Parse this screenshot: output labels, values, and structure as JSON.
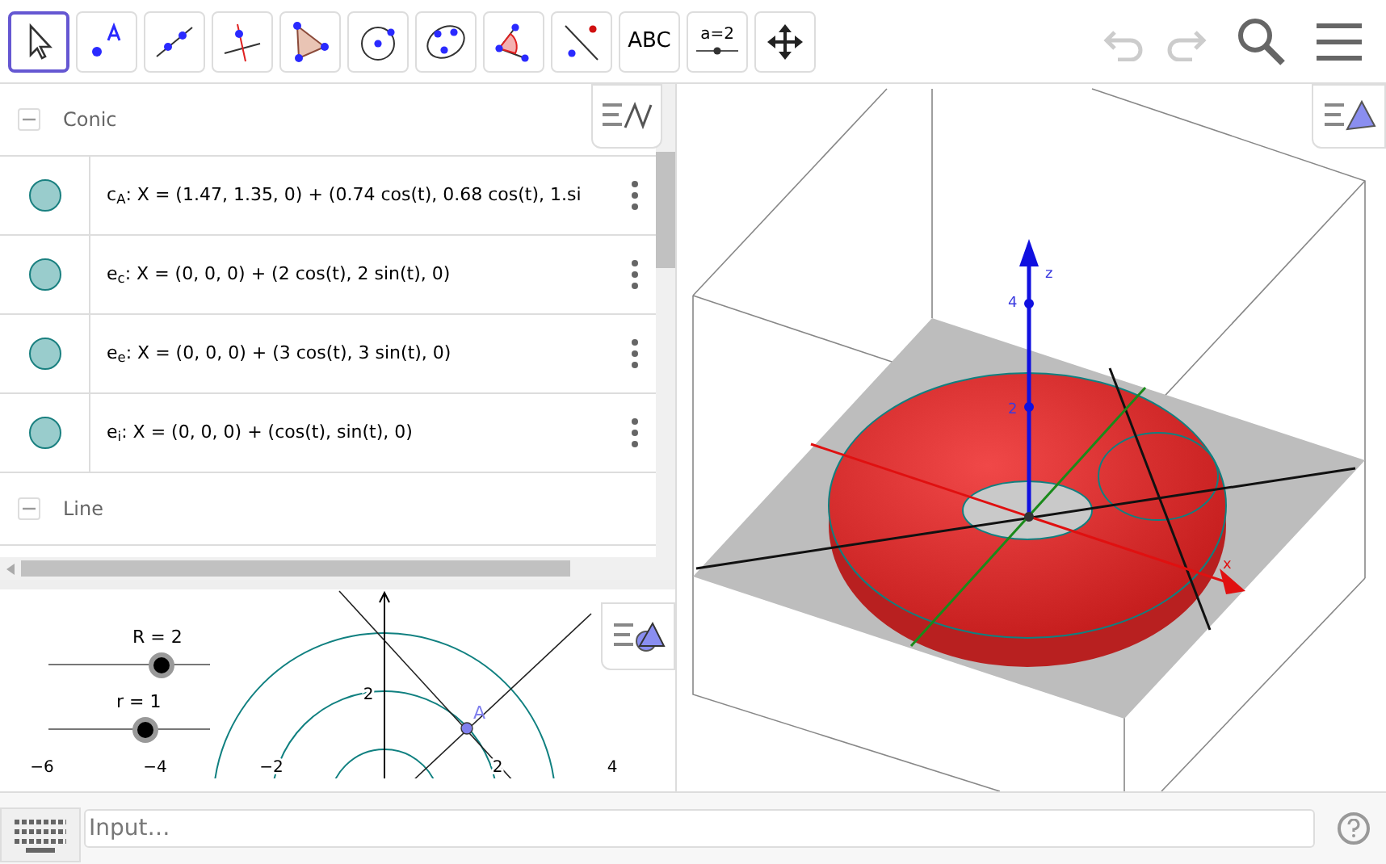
{
  "toolbar": {
    "tools": [
      {
        "kind": "move",
        "selected": true
      },
      {
        "kind": "point",
        "selected": false
      },
      {
        "kind": "line",
        "selected": false
      },
      {
        "kind": "perpendicular",
        "selected": false
      },
      {
        "kind": "polygon",
        "selected": false
      },
      {
        "kind": "circle",
        "selected": false
      },
      {
        "kind": "conic",
        "selected": false
      },
      {
        "kind": "angle",
        "selected": false
      },
      {
        "kind": "reflect",
        "selected": false
      },
      {
        "kind": "text",
        "label": "ABC",
        "selected": false
      },
      {
        "kind": "slider",
        "label": "a=2",
        "selected": false
      },
      {
        "kind": "pan",
        "selected": false
      }
    ],
    "undo": {
      "disabled": true
    },
    "redo": {
      "disabled": true
    }
  },
  "algebra": {
    "groups": [
      {
        "title": "Conic",
        "expanded": true,
        "rows": [
          {
            "text": "c$_{A}$: X = (1.47, 1.35, 0) + (0.74 cos(t), 0.68 cos(t), 1.si"
          },
          {
            "text": "e$_{c}$: X = (0, 0, 0) + (2 cos(t), 2 sin(t), 0)"
          },
          {
            "text": "e$_{e}$: X = (0, 0, 0) + (3 cos(t), 3 sin(t), 0)"
          },
          {
            "text": "e$_{i}$: X = (0, 0, 0) + (cos(t), sin(t), 0)"
          }
        ]
      },
      {
        "title": "Line",
        "expanded": true
      }
    ]
  },
  "graphics": {
    "sliders": [
      {
        "label": "R = 2",
        "level": 0.7
      },
      {
        "label": "r = 1",
        "level": 0.6
      }
    ],
    "x_ticks": [
      "−6",
      "−4",
      "−2",
      "2",
      "4"
    ],
    "y_ticks": [
      "2"
    ],
    "point": "A"
  },
  "view_3d": {
    "axis_labels": [
      "z",
      "4",
      "2",
      "x"
    ]
  },
  "input_bar": {
    "placeholder": "Input…"
  }
}
